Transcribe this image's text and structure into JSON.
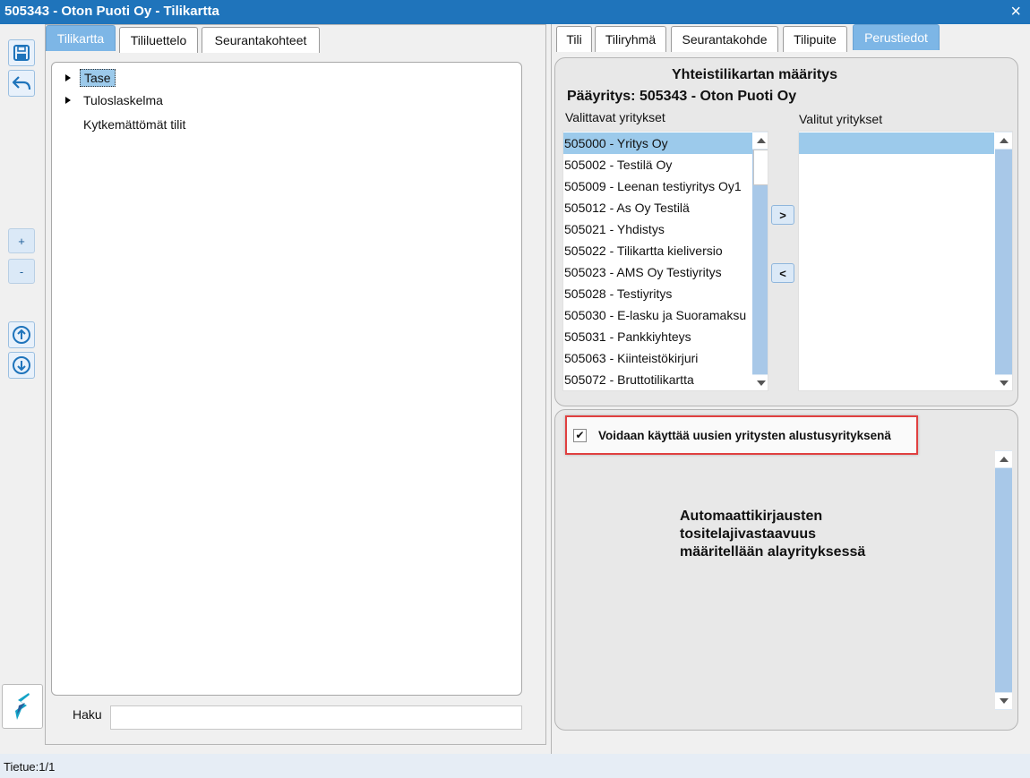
{
  "window": {
    "title": "505343 - Oton Puoti Oy - Tilikartta",
    "close_icon": "×"
  },
  "sidebar": {
    "save_icon": "save-icon",
    "undo_icon": "undo-icon",
    "expand_label": "+",
    "collapse_label": "-",
    "move_up_icon": "arrow-up-circle-icon",
    "move_down_icon": "arrow-down-circle-icon",
    "logo_icon": "app-logo-icon"
  },
  "left": {
    "tabs": [
      "Tilikartta",
      "Tililuettelo",
      "Seurantakohteet"
    ],
    "tree": [
      "Tase",
      "Tuloslaskelma",
      "Kytkemättömät tilit"
    ],
    "search_label": "Haku",
    "search_value": ""
  },
  "right": {
    "tabs": [
      "Tili",
      "Tiliryhmä",
      "Seurantakohde",
      "Tilipuite",
      "Perustiedot"
    ],
    "heading": "Yhteistilikartan määritys",
    "parent_company": "Pääyritys: 505343 - Oton Puoti Oy",
    "available_label": "Valittavat yritykset",
    "selected_label": "Valitut yritykset",
    "available": [
      "505000 - Yritys Oy",
      "505002 - Testilä Oy",
      "505009 - Leenan testiyritys Oy1",
      "505012 - As Oy Testilä",
      "505021 - Yhdistys",
      "505022 - Tilikartta kieliversio",
      "505023 - AMS Oy Testiyritys",
      "505028 - Testiyritys",
      "505030 - E-lasku ja Suoramaksu",
      "505031 - Pankkiyhteys",
      "505063 - Kiinteistökirjuri",
      "505072 - Bruttotilikartta"
    ],
    "selected": [
      ""
    ],
    "add_label": ">",
    "remove_label": "<",
    "checkbox_mark": "✔",
    "checkbox_checked": true,
    "checkbox_label": "Voidaan käyttää uusien yritysten alustusyrityksenä",
    "info_text": "Automaattikirjausten\ntositelajivastaavuus\nmääritellään alayrityksessä"
  },
  "status": {
    "text": "Tietue:1/1"
  },
  "colors": {
    "titlebar": "#1f74bb",
    "active_tab": "#7db6e6",
    "selection": "#9ccaeb",
    "highlight_border": "#e04040"
  }
}
